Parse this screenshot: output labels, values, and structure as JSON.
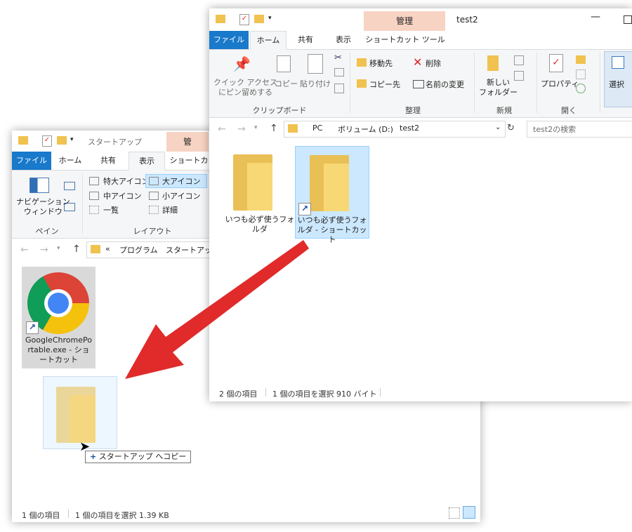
{
  "front_window": {
    "title": "test2",
    "context_tab": "管理",
    "tabs": [
      "ファイル",
      "ホーム",
      "共有",
      "表示",
      "ショートカット ツール"
    ],
    "ribbon": {
      "pin": "クイック アクセス\nにピン留めする",
      "copy": "コピー",
      "paste": "貼り付け",
      "group_clipboard": "クリップボード",
      "move_to": "移動先",
      "delete": "削除",
      "copy_to": "コピー先",
      "rename": "名前の変更",
      "group_organize": "整理",
      "new_folder": "新しい\nフォルダー",
      "group_new": "新規",
      "properties": "プロパティ",
      "group_open": "開く",
      "select": "選択"
    },
    "address": [
      "PC",
      "ボリューム (D:)",
      "test2"
    ],
    "search_placeholder": "test2の検索",
    "items": [
      "いつも必ず使うフォルダ",
      "いつも必ず使うフォルダ - ショートカット"
    ],
    "status": {
      "count": "2 個の項目",
      "selected": "1 個の項目を選択  910 バイト"
    }
  },
  "back_window": {
    "title": "スタートアップ",
    "context_tab": "管",
    "tabs": [
      "ファイル",
      "ホーム",
      "共有",
      "表示",
      "ショートカ"
    ],
    "ribbon": {
      "nav_pane": "ナビゲーション\nウィンドウ",
      "group_pane": "ペイン",
      "extra_large": "特大アイコン",
      "large": "大アイコン",
      "medium": "中アイコン",
      "small": "小アイコン",
      "list": "一覧",
      "details": "詳細",
      "group_layout": "レイアウト"
    },
    "address": [
      "«",
      "プログラム",
      "スタートアップ"
    ],
    "items": [
      "GoogleChromePortable.exe - ショートカット"
    ],
    "status": {
      "count": "1 個の項目",
      "selected": "1 個の項目を選択  1.39 KB"
    }
  },
  "drag": {
    "tooltip": "スタートアップ へコピー"
  },
  "colors": {
    "file_tab": "#1979ca",
    "context_tab": "#f7d3c3",
    "selection": "#cce8ff",
    "arrow": "#e12a2a"
  }
}
